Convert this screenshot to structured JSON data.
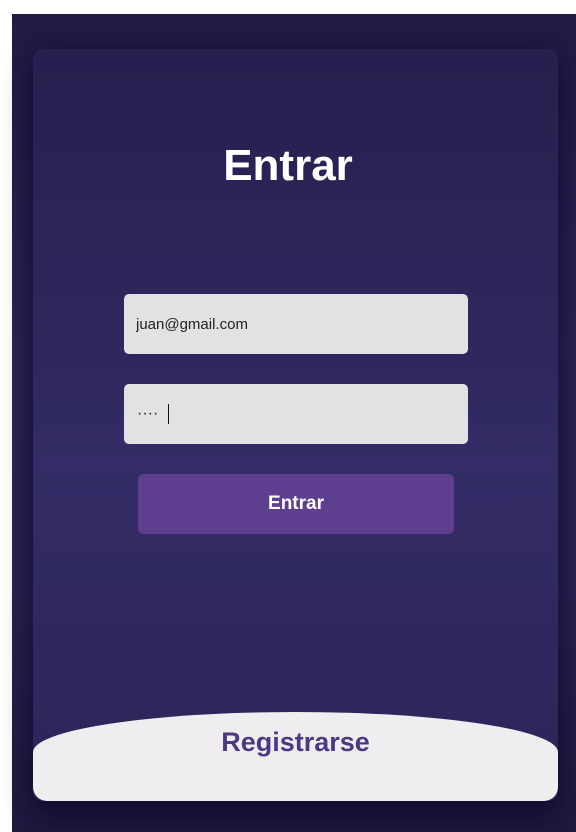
{
  "login_form": {
    "title": "Entrar",
    "email_value": "juan@gmail.com",
    "password_masked": "····",
    "submit_label": "Entrar"
  },
  "register": {
    "label": "Registrarse"
  },
  "colors": {
    "background": "#2b2458",
    "input_fill": "#e3e1e3",
    "submit_button": "#5e3f8f",
    "register_text": "#4f3883",
    "register_panel": "#efedf0"
  }
}
